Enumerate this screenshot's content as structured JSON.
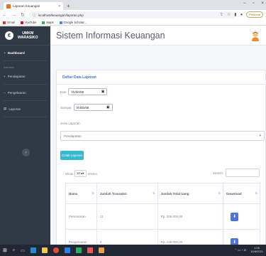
{
  "browser": {
    "tab_title": "Laporan Keuangan",
    "url": "localhost/keuangan/laporan.php",
    "profile_label": "Personal",
    "bookmarks": [
      "Gmail",
      "YouTube",
      "Maps",
      "Google Scholar..."
    ]
  },
  "sidebar": {
    "brand_line1": "UMKM",
    "brand_line2": "WARASIKO",
    "dashboard": "Dashboard",
    "section": "Interface",
    "items": [
      "Pendapatan",
      "Pengeluaran",
      "Laporan"
    ],
    "toggle_icon": "chevron-left"
  },
  "topbar": {
    "title": "Sistem Informasi Keuangan"
  },
  "card": {
    "header": "Daftar Data Laporan",
    "dari_label": "Dari",
    "dari_value": "hh/bb/tttt",
    "sampai_label": "Sampai",
    "sampai_value": "hh/bb/tttt",
    "jenis_label": "Jenis Laporan",
    "jenis_value": "Pendapatan",
    "cetak_button": "Cetak Laporan",
    "show_label": "Show",
    "show_value": "10",
    "entries_label": "entries",
    "search_label": "Search:"
  },
  "table": {
    "headers": [
      "Nama",
      "Jumlah Transaksi",
      "Jumlah Total Uang",
      "Download"
    ],
    "rows": [
      [
        "Pemasukan",
        "11",
        "Rp. 336.000,00"
      ],
      [
        "Pengeluaran",
        "5",
        "Rp. 139.000,00"
      ]
    ]
  },
  "taskbar": {
    "time": "1:05",
    "date": "10/8/2021"
  }
}
